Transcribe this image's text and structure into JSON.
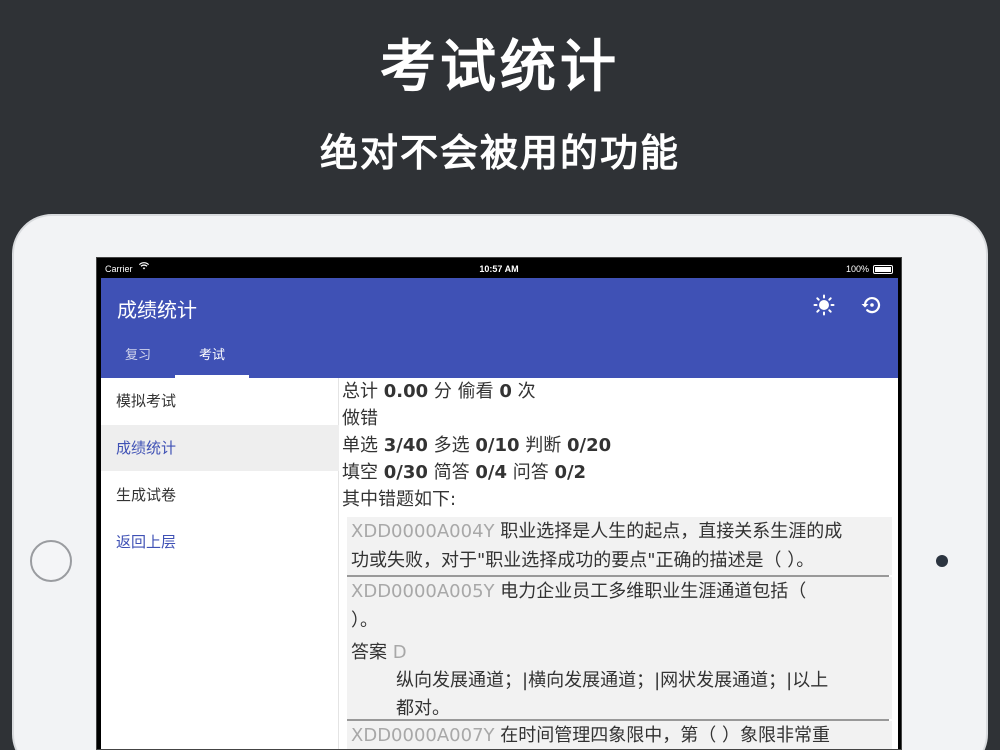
{
  "promo": {
    "title": "考试统计",
    "subtitle": "绝对不会被用的功能"
  },
  "statusbar": {
    "carrier": "Carrier",
    "time": "10:57 AM",
    "battery": "100%"
  },
  "appbar": {
    "title": "成绩统计",
    "icons": [
      "sun-icon",
      "history-icon"
    ],
    "tabs": [
      {
        "label": "复习",
        "selected": false
      },
      {
        "label": "考试",
        "selected": true
      }
    ],
    "color": "#3f51b5"
  },
  "sidebar": {
    "items": [
      {
        "label": "模拟考试",
        "state": "normal"
      },
      {
        "label": "成绩统计",
        "state": "active"
      },
      {
        "label": "生成试卷",
        "state": "normal"
      },
      {
        "label": "返回上层",
        "state": "link"
      }
    ]
  },
  "summary": {
    "total_label": "总计",
    "total_score": "0.00",
    "score_unit": "分",
    "peek_label": "偷看",
    "peek_count": "0",
    "peek_unit": "次",
    "wrong_label": "做错",
    "single_label": "单选",
    "single_value": "3/40",
    "multi_label": "多选",
    "multi_value": "0/10",
    "judge_label": "判断",
    "judge_value": "0/20",
    "fill_label": "填空",
    "fill_value": "0/30",
    "short_label": "简答",
    "short_value": "0/4",
    "qa_label": "问答",
    "qa_value": "0/2",
    "wrong_list_label": "其中错题如下:"
  },
  "questions": [
    {
      "id": "XDD0000A004Y",
      "line1": "职业选择是人生的起点，直接关系生涯的成",
      "line2": "功或失败，对于\"职业选择成功的要点\"正确的描述是（    ）。"
    },
    {
      "id": "XDD0000A005Y",
      "line1": "电力企业员工多维职业生涯通道包括（",
      "line2": "）。",
      "answer_label": "答案",
      "answer_value": "D",
      "answer_line1": "纵向发展通道；|横向发展通道；|网状发展通道；|以上",
      "answer_line2": "都对。"
    },
    {
      "id": "XDD0000A007Y",
      "line1": "在时间管理四象限中，第（    ）象限非常重"
    }
  ]
}
